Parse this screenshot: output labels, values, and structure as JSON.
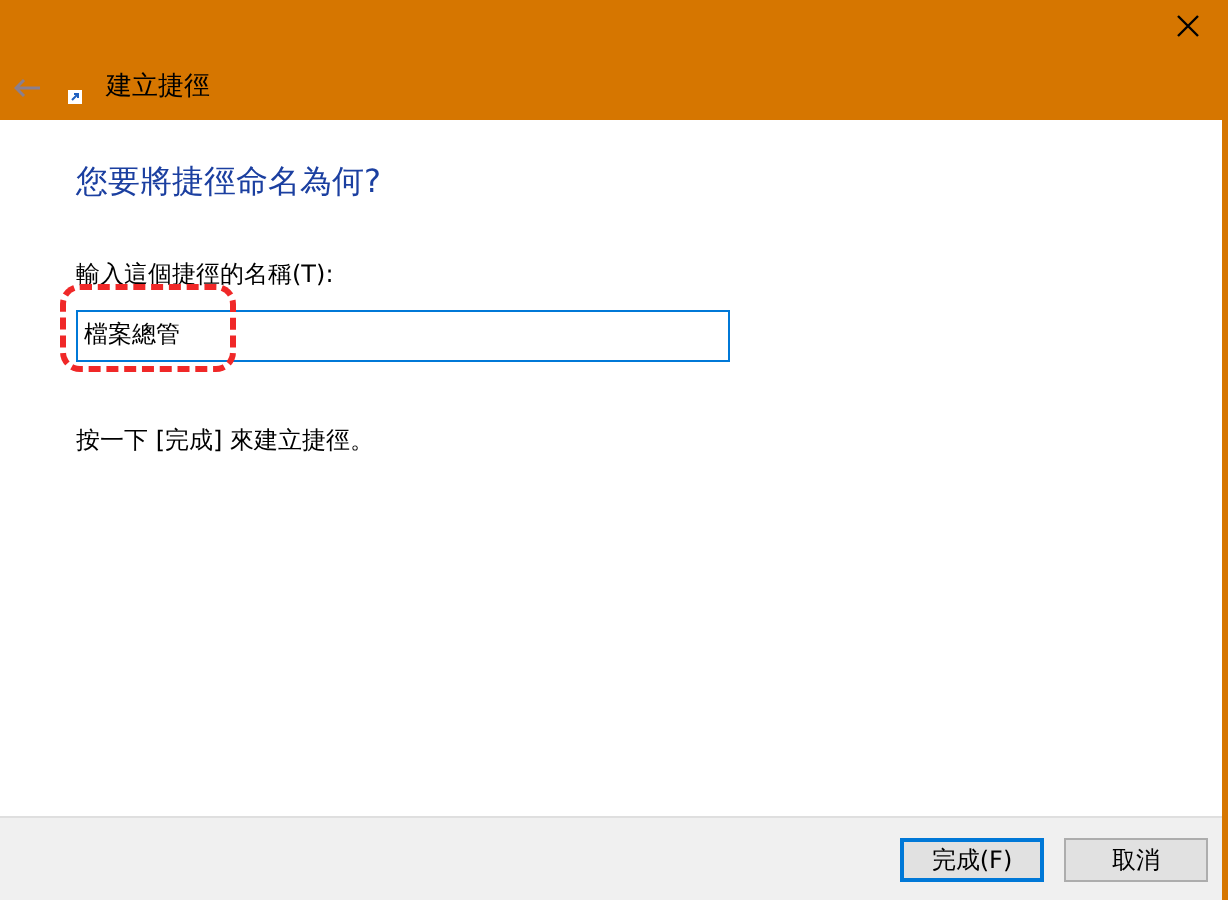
{
  "window": {
    "title": "建立捷徑"
  },
  "heading": "您要將捷徑命名為何?",
  "name_field": {
    "label": "輸入這個捷徑的名稱(T):",
    "value": "檔案總管",
    "highlighted": true
  },
  "hint": "按一下 [完成] 來建立捷徑。",
  "buttons": [
    {
      "label": "完成(F)",
      "selected": true
    },
    {
      "label": "取消",
      "selected": false
    }
  ]
}
